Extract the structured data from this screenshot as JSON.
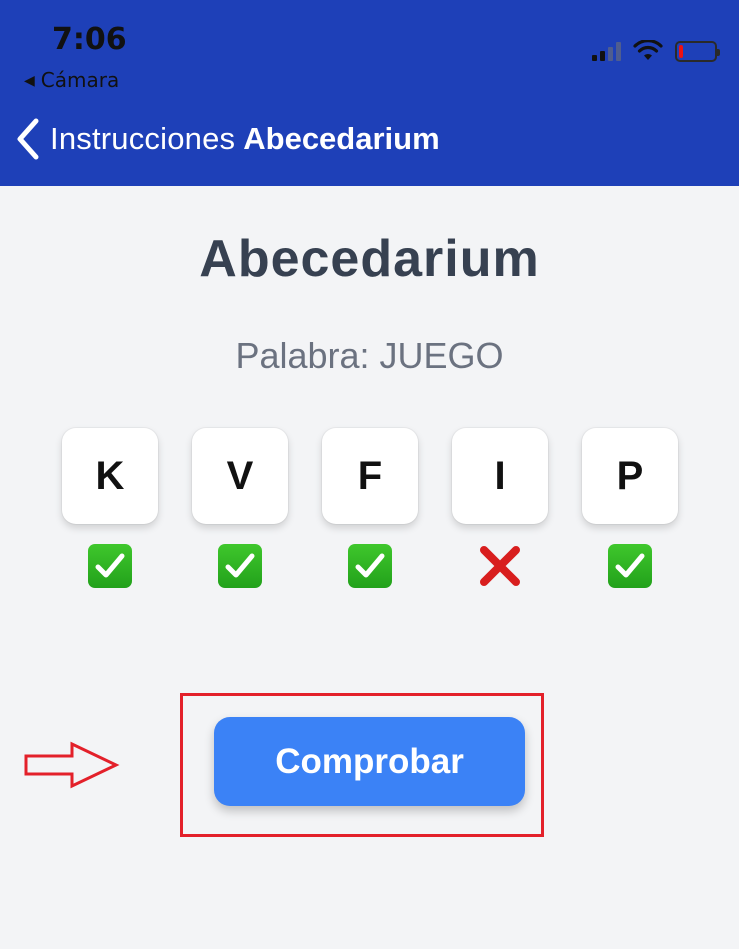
{
  "status_bar": {
    "time": "7:06",
    "back_app_label": "Cámara",
    "icons": [
      "signal-icon",
      "wifi-icon",
      "battery-icon"
    ]
  },
  "nav": {
    "back_label": "Instrucciones",
    "title": "Abecedarium"
  },
  "main": {
    "title": "Abecedarium",
    "word_label": "Palabra: JUEGO",
    "letters": [
      {
        "letter": "K",
        "result": "correct"
      },
      {
        "letter": "V",
        "result": "correct"
      },
      {
        "letter": "F",
        "result": "correct"
      },
      {
        "letter": "I",
        "result": "incorrect"
      },
      {
        "letter": "P",
        "result": "correct"
      }
    ],
    "check_button_label": "Comprobar"
  },
  "colors": {
    "header_bg": "#1e40b8",
    "page_bg": "#f3f4f6",
    "title": "#374151",
    "subtitle": "#6b7280",
    "button": "#3b82f6",
    "annotation_red": "#e3202a",
    "correct_green": "#2fb323",
    "incorrect_red": "#d81e1e"
  }
}
